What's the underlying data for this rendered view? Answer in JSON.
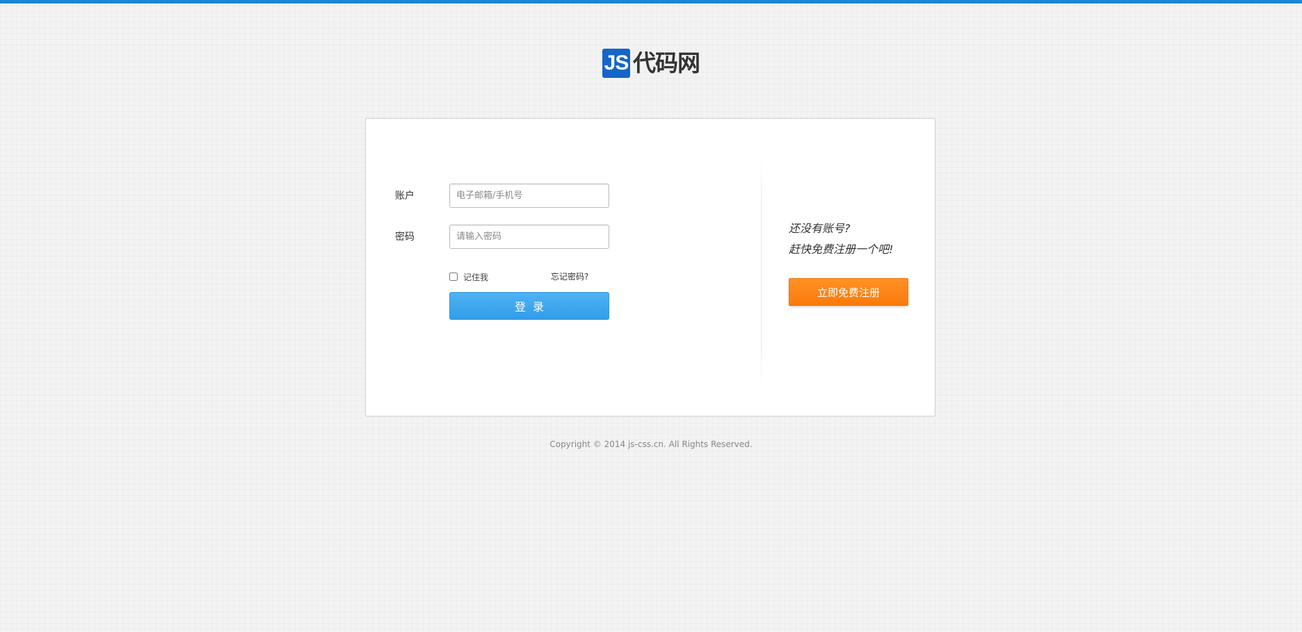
{
  "logo": {
    "badge": "JS",
    "text": "代码网"
  },
  "login": {
    "account_label": "账户",
    "account_placeholder": "电子邮箱/手机号",
    "account_value": "",
    "password_label": "密码",
    "password_placeholder": "请输入密码",
    "password_value": "",
    "remember_label": "记住我",
    "remember_checked": false,
    "forgot_link": "忘记密码?",
    "submit_label": "登录"
  },
  "register": {
    "line1": "还没有账号?",
    "line2": "赶快免费注册一个吧!",
    "button_label": "立即免费注册"
  },
  "footer": {
    "copyright": "Copyright © 2014 js-css.cn. All Rights Reserved."
  },
  "colors": {
    "top_bar": "#1a87d4",
    "logo_badge": "#1565c8",
    "login_button": "#3aa3ef",
    "register_button": "#fb8317"
  }
}
